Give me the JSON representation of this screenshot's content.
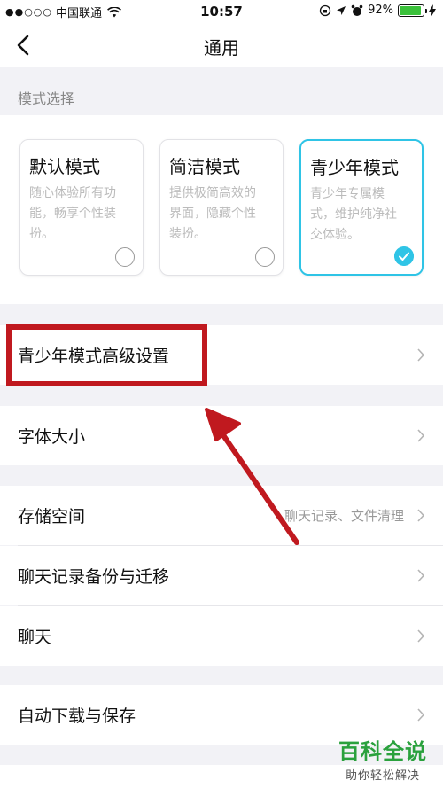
{
  "status_bar": {
    "signal_dots": "●●○○○",
    "carrier": "中国联通",
    "time": "10:57",
    "battery_percent": "92%",
    "battery_level": 0.92
  },
  "nav": {
    "title": "通用"
  },
  "mode_section": {
    "label": "模式选择",
    "modes": [
      {
        "title": "默认模式",
        "desc_lines": [
          "随心体验所有功",
          "能，畅享个性装",
          "扮。"
        ],
        "selected": false
      },
      {
        "title": "简洁模式",
        "desc_lines": [
          "提供极简高效的",
          "界面，隐藏个性",
          "装扮。"
        ],
        "selected": false
      },
      {
        "title": "青少年模式",
        "desc_lines": [
          "青少年专属模",
          "式，维护纯净社",
          "交体验。"
        ],
        "selected": true
      }
    ]
  },
  "rows": {
    "youth_advanced": "青少年模式高级设置",
    "font_size": "字体大小",
    "storage": "存储空间",
    "storage_value": "聊天记录、文件清理",
    "chat_backup": "聊天记录备份与迁移",
    "chat": "聊天",
    "auto_download": "自动下载与保存"
  },
  "colors": {
    "accent": "#2fc4e6",
    "annotation_red": "#c0191f",
    "watermark_green": "#2aa13d"
  },
  "watermark": {
    "main": "百科全说",
    "sub": "助你轻松解决"
  }
}
